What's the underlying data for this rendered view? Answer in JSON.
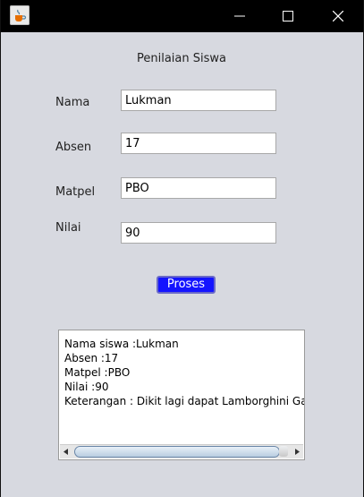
{
  "window": {
    "title": "Penilaian Siswa",
    "controls": {
      "minimize_icon": "minimize-icon",
      "maximize_icon": "maximize-icon",
      "close_icon": "close-icon"
    },
    "app_icon": "java-cup-icon"
  },
  "form": {
    "nama": {
      "label": "Nama",
      "value": "Lukman"
    },
    "absen": {
      "label": "Absen",
      "value": "17"
    },
    "matpel": {
      "label": "Matpel",
      "value": "PBO"
    },
    "nilai": {
      "label": "Nilai",
      "value": "90"
    }
  },
  "proses_button": {
    "label": "Proses",
    "color": "#1414ff"
  },
  "output": {
    "lines": [
      "Nama siswa :Lukman",
      "Absen :17",
      "Matpel :PBO",
      "Nilai :90",
      "Keterangan : Dikit lagi dapat Lamborghini Galard"
    ]
  }
}
